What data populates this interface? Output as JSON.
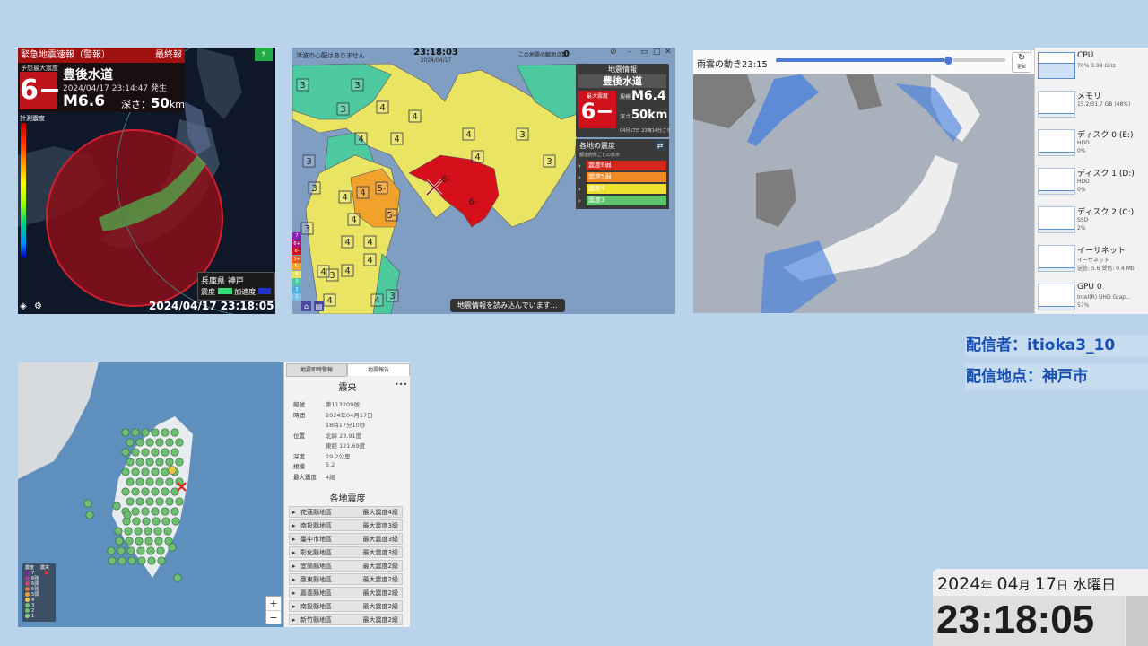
{
  "eew": {
    "header": "緊急地震速報（警報）",
    "final": "最終報",
    "max_label": "予想最大震度",
    "intensity": "6−",
    "region": "豊後水道",
    "time": "2024/04/17 23:14:47 発生",
    "magnitude": "M6.6",
    "depth_label": "深さ：",
    "depth_value": "50",
    "depth_unit": "km",
    "scale_label": "計測震度",
    "station": "兵庫県 神戸",
    "legend_intensity": "震度",
    "legend_accel": "加速度",
    "clock": "2024/04/17 23:18:05",
    "colors": {
      "header": "#a01010",
      "circle": "#8a0f17"
    }
  },
  "quake": {
    "top_left": "津波の心配はありません",
    "time": "23:18:03",
    "date": "2024/04/17",
    "observed_label": "この地震の観測点数",
    "observed_count": "0",
    "info_title": "地震情報",
    "region": "豊後水道",
    "max_label": "最大震度",
    "intensity": "6−",
    "scale_label": "規模",
    "magnitude": "M6.4",
    "depth_label": "深さ",
    "depth": "50km",
    "timestamp": "04月17日 23時14分ごろ",
    "areas_title": "各地の震度",
    "areas_sub": "都道府県ごとの表示",
    "rows": [
      {
        "label": "震度6弱",
        "color": "#d9261c"
      },
      {
        "label": "震度5弱",
        "color": "#f08a24"
      },
      {
        "label": "震度4",
        "color": "#f0e030"
      },
      {
        "label": "震度3",
        "color": "#5ec36b"
      }
    ],
    "map_legend": [
      "7",
      "6+",
      "6-",
      "5+",
      "5-",
      "4",
      "3",
      "2",
      "1"
    ],
    "loading": "地震情報を読み込んでいます…",
    "map_labels": [
      "3",
      "3",
      "4",
      "4",
      "3",
      "3",
      "4",
      "4",
      "3",
      "3",
      "4",
      "4",
      "4",
      "4",
      "3",
      "3",
      "4",
      "5-",
      "5-",
      "4",
      "4",
      "3",
      "4",
      "4",
      "4",
      "4",
      "4",
      "3",
      "6-",
      "6-"
    ]
  },
  "radar": {
    "title": "雨雲の動き23:15",
    "slider_value": 0.75,
    "refresh": "更新"
  },
  "monitor": {
    "items": [
      {
        "name": "CPU",
        "line1": "70%  3.98 GHz",
        "line2": ""
      },
      {
        "name": "メモリ",
        "line1": "15.2/31.7 GB (48%)",
        "line2": ""
      },
      {
        "name": "ディスク 0 (E:)",
        "line1": "HDD",
        "line2": "0%"
      },
      {
        "name": "ディスク 1 (D:)",
        "line1": "HDD",
        "line2": "0%"
      },
      {
        "name": "ディスク 2 (C:)",
        "line1": "SSD",
        "line2": "2%"
      },
      {
        "name": "イーサネット",
        "line1": "イーサネット",
        "line2": "送信: 5.6  受信: 0.4 Mb"
      },
      {
        "name": "GPU 0",
        "line1": "Intel(R) UHD Grap...",
        "line2": "57%"
      }
    ]
  },
  "streamer": {
    "name_line": "配信者：itioka3_10",
    "location_line": "配信地点：神戸市"
  },
  "taiwan": {
    "tabs": [
      "地震即時警報",
      "地震報告"
    ],
    "section": "震央",
    "more": "•••",
    "fields": [
      {
        "label": "編號",
        "value": "第113209號"
      },
      {
        "label": "時間",
        "value": "2024年04月17日"
      },
      {
        "label": "",
        "value": "18時17分10秒"
      },
      {
        "label": "位置",
        "value": "北緯 23.91度"
      },
      {
        "label": "",
        "value": "東經 121.69度"
      },
      {
        "label": "深度",
        "value": "19.2公里"
      },
      {
        "label": "規模",
        "value": "5.2"
      },
      {
        "label": "最大震度",
        "value": "4級"
      }
    ],
    "areas_title": "各地震度",
    "areas": [
      {
        "name": "花蓮縣地區",
        "value": "最大震度4級"
      },
      {
        "name": "南投縣地區",
        "value": "最大震度3級"
      },
      {
        "name": "臺中市地區",
        "value": "最大震度3級"
      },
      {
        "name": "彰化縣地區",
        "value": "最大震度3級"
      },
      {
        "name": "宜蘭縣地區",
        "value": "最大震度2級"
      },
      {
        "name": "臺東縣地區",
        "value": "最大震度2級"
      },
      {
        "name": "嘉義縣地區",
        "value": "最大震度2級"
      },
      {
        "name": "南投縣地區",
        "value": "最大震度2級"
      },
      {
        "name": "新竹縣地區",
        "value": "最大震度2級"
      }
    ],
    "legend_head": [
      "震度",
      "震央"
    ],
    "legend_levels": [
      "7",
      "6強",
      "6弱",
      "5強",
      "5弱",
      "4",
      "3",
      "2",
      "1"
    ],
    "zoom_in": "+",
    "zoom_out": "−"
  },
  "datetime": {
    "year": "2024",
    "year_unit": "年",
    "month": "04",
    "month_unit": "月",
    "day": "17",
    "day_unit": "日",
    "weekday": "水曜日",
    "time": "23:18:05"
  }
}
